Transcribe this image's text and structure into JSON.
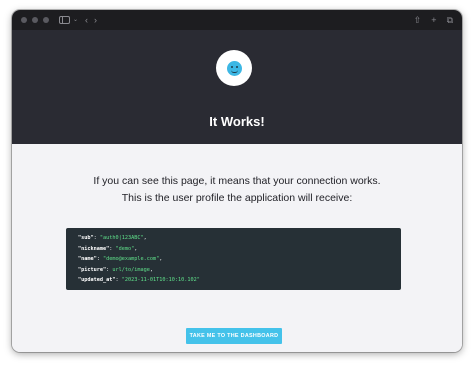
{
  "titlebar": {
    "back_icon": "chevron-left-icon",
    "forward_icon": "chevron-right-icon",
    "share_icon": "share-icon",
    "new_tab_icon": "plus-icon",
    "tabs_icon": "tabs-overview-icon"
  },
  "hero": {
    "avatar_icon": "smiley-face-icon",
    "avatar_color": "#3db7e4",
    "title": "It Works!",
    "background": "#2a2b33"
  },
  "main": {
    "line1": "If you can see this page, it means that your connection works.",
    "line2": "This is the user profile the application will receive:"
  },
  "profile": [
    {
      "key": "\"sub\"",
      "value": "\"auth0|123ABC\"",
      "sep": ","
    },
    {
      "key": "\"nickname\"",
      "value": "\"demo\"",
      "sep": ","
    },
    {
      "key": "\"name\"",
      "value": "\"demo@example.com\"",
      "sep": ","
    },
    {
      "key": "\"picture\"",
      "value": "url/to/image",
      "sep": ","
    },
    {
      "key": "\"updated_at\"",
      "value": "\"2023-11-01T10:10:10.102\"",
      "sep": ""
    }
  ],
  "cta": {
    "label": "TAKE ME TO THE DASHBOARD",
    "color": "#44c2ea"
  }
}
